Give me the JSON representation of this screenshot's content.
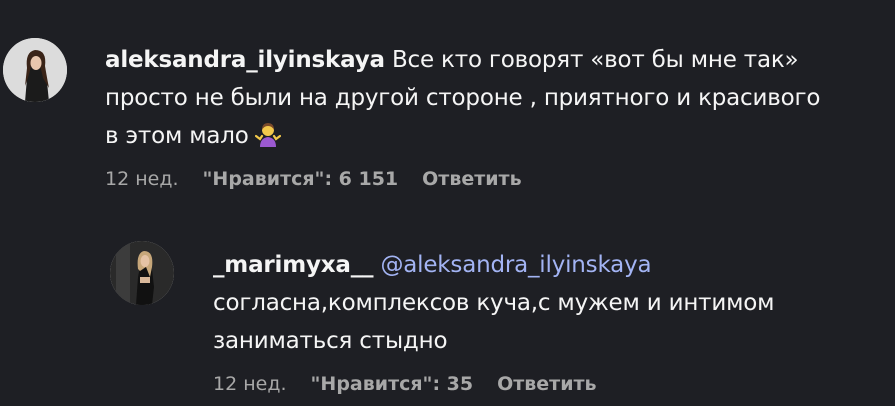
{
  "comments": [
    {
      "username": "aleksandra_ilyinskaya",
      "text_line1": "Все кто говорят «вот бы мне так»",
      "text_line2": "просто не были на другой стороне , приятного и красивого",
      "text_line3": "в этом мало",
      "emoji": "person-shrugging",
      "time": "12 нед.",
      "likes": "\"Нравится\": 6 151",
      "reply_label": "Ответить"
    }
  ],
  "replies": [
    {
      "username": "_marimyxa__",
      "mention": "@aleksandra_ilyinskaya",
      "text_line1": "согласна,комплексов куча,с мужем и интимом",
      "text_line2": "заниматься стыдно",
      "time": "12 нед.",
      "likes": "\"Нравится\": 35",
      "reply_label": "Ответить"
    }
  ],
  "colors": {
    "background": "#1e1f24",
    "text": "#f5f5f5",
    "meta": "#a8a8a8",
    "mention": "#a3b4f4"
  }
}
